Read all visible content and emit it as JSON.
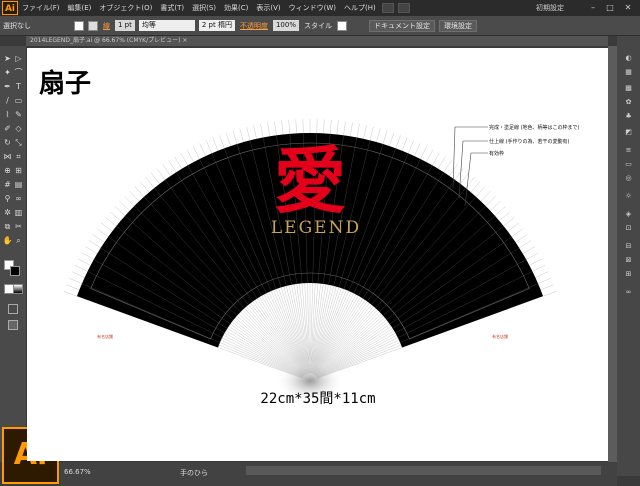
{
  "app": {
    "logo": "Ai",
    "workspace": "初期設定"
  },
  "menu": [
    "ファイル(F)",
    "編集(E)",
    "オブジェクト(O)",
    "書式(T)",
    "選択(S)",
    "効果(C)",
    "表示(V)",
    "ウィンドウ(W)",
    "ヘルプ(H)"
  ],
  "control": {
    "selection": "選択なし",
    "stroke_label": "線",
    "stroke_weight": "1 pt",
    "profile_label": "均等",
    "brush_label": "2 pt 楕円",
    "opacity_label": "不透明度",
    "opacity_value": "100%",
    "style_label": "スタイル",
    "doc_settings": "ドキュメント設定",
    "prefs": "環境設定"
  },
  "document_tab": "2014LEGEND_扇子.ai @ 66.67% (CMYK/プレビュー) ×",
  "artwork": {
    "title": "扇子",
    "kanji": "愛",
    "brand": "LEGEND",
    "small_left": "有名店舗",
    "small_right": "有名店舗",
    "legend_lines": [
      "完成・塗足線 (地色、柄等はこの枠まで)",
      "仕上線 (手作りの為、若干の変動有)",
      "有効枠"
    ],
    "spec": "22cm*35間*11cm"
  },
  "status": {
    "zoom": "66.67%",
    "tool": "手のひら"
  },
  "colors": {
    "fan": "#000000",
    "kanji": "#e4001b",
    "brand": "#c9a45a",
    "accent": "#ff9a00"
  },
  "toolbox": [
    "selection-icon",
    "direct-select-icon",
    "magic-wand-icon",
    "lasso-icon",
    "pen-icon",
    "type-icon",
    "line-icon",
    "rectangle-icon",
    "paintbrush-icon",
    "pencil-icon",
    "blob-brush-icon",
    "eraser-icon",
    "rotate-icon",
    "scale-icon",
    "width-icon",
    "free-transform-icon",
    "shape-builder-icon",
    "perspective-icon",
    "mesh-icon",
    "gradient-icon",
    "eyedropper-icon",
    "blend-icon",
    "symbol-sprayer-icon",
    "graph-icon",
    "artboard-icon",
    "slice-icon",
    "hand-icon",
    "zoom-icon"
  ],
  "panels": [
    "color-panel-icon",
    "color-guide-icon",
    "swatches-icon",
    "brushes-icon",
    "symbols-icon",
    "graphic-styles-icon",
    "stroke-icon",
    "gradient-panel-icon",
    "transparency-icon",
    "appearance-icon",
    "layers-icon",
    "artboards-icon",
    "align-icon",
    "transform-icon",
    "pathfinder-icon",
    "links-icon"
  ]
}
